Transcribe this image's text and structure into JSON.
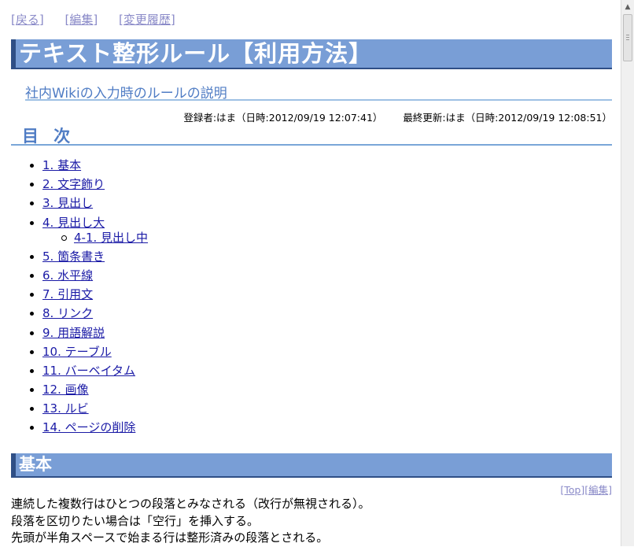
{
  "nav": {
    "back": "[戻る]",
    "edit": "[編集]",
    "history": "[変更履歴]"
  },
  "page": {
    "title": "テキスト整形ルール【利用方法】",
    "subtitle": "社内Wikiの入力時のルールの説明",
    "registered": "登録者:はま（日時:2012/09/19 12:07:41）",
    "updated": "最終更新:はま（日時:2012/09/19 12:08:51）"
  },
  "toc": {
    "heading": "目 次",
    "items": [
      {
        "label": "1. 基本",
        "level": 1
      },
      {
        "label": "2. 文字飾り",
        "level": 1
      },
      {
        "label": "3. 見出し",
        "level": 1
      },
      {
        "label": "4. 見出し大",
        "level": 1
      },
      {
        "label": "4-1. 見出し中",
        "level": 2
      },
      {
        "label": "5. 箇条書き",
        "level": 1
      },
      {
        "label": "6. 水平線",
        "level": 1
      },
      {
        "label": "7. 引用文",
        "level": 1
      },
      {
        "label": "8. リンク",
        "level": 1
      },
      {
        "label": "9. 用語解説",
        "level": 1
      },
      {
        "label": "10. テーブル",
        "level": 1
      },
      {
        "label": "11. バーベイタム",
        "level": 1
      },
      {
        "label": "12. 画像",
        "level": 1
      },
      {
        "label": "13. ルビ",
        "level": 1
      },
      {
        "label": "14. ページの削除",
        "level": 1
      }
    ]
  },
  "section": {
    "heading": "基本",
    "top_link": "[Top]",
    "edit_link": "[編集]",
    "lines": [
      "連続した複数行はひとつの段落とみなされる（改行が無視される）。",
      "段落を区切りたい場合は「空行」を挿入する。",
      "先頭が半角スペースで始まる行は整形済みの段落とされる。"
    ]
  }
}
